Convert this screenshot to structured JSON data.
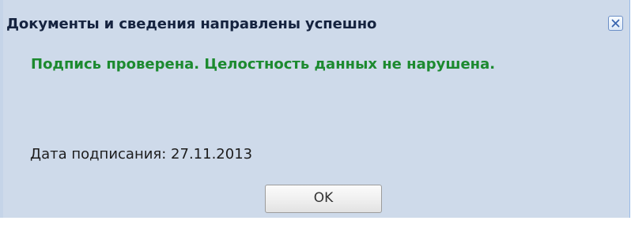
{
  "dialog": {
    "title": "Документы и сведения направлены успешно",
    "close_icon": "close-icon",
    "status_message": "Подпись проверена. Целостность данных не нарушена.",
    "sign_date_label": "Дата подписания:",
    "sign_date_value": "27.11.2013",
    "ok_label": "OK"
  },
  "colors": {
    "background": "#cedaea",
    "title": "#15233f",
    "status_success": "#1c8a2f",
    "text": "#1d1d1d"
  }
}
